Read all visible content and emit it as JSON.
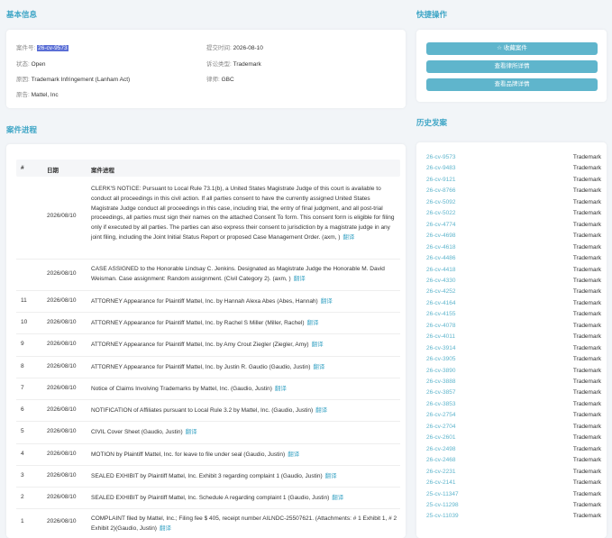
{
  "basic_info": {
    "title": "基本信息",
    "case_no_label": "案件号:",
    "case_no": "26-cv-9573",
    "filed_label": "提交时间:",
    "filed": "2026-08-10",
    "status_label": "状态:",
    "status": "Open",
    "type_label": "诉讼类型:",
    "type": "Trademark",
    "cause_label": "原因:",
    "cause": "Trademark Infringement (Lanham Act)",
    "lawyer_label": "律师:",
    "lawyer": "GBC",
    "plaintiff_label": "原告:",
    "plaintiff": "Mattel, Inc"
  },
  "quick_actions": {
    "title": "快捷操作",
    "favorite_icon": "star-icon",
    "favorite_label": "收藏案件",
    "lawyer_details": "查看律所详情",
    "brand_details": "查看品牌详情"
  },
  "progress": {
    "title": "案件进程",
    "col_num": "#",
    "col_date": "日期",
    "col_text": "案件进程",
    "translate_label": "翻译",
    "rows": [
      {
        "num": "",
        "date": "2026/08/10",
        "text": "CLERK'S NOTICE: Pursuant to Local Rule 73.1(b), a United States Magistrate Judge of this court is available to conduct all proceedings in this civil action. If all parties consent to have the currently assigned United States Magistrate Judge conduct all proceedings in this case, including trial, the entry of final judgment, and all post-trial proceedings, all parties must sign their names on the attached Consent To form. This consent form is eligible for filing only if executed by all parties. The parties can also express their consent to jurisdiction by a magistrate judge in any joint filing, including the Joint Initial Status Report or proposed Case Management Order. (axm, )"
      },
      {
        "num": "",
        "date": "2026/08/10",
        "text": "CASE ASSIGNED to the Honorable Lindsay C. Jenkins. Designated as Magistrate Judge the Honorable M. David Weisman. Case assignment: Random assignment. (Civil Category 2). (axm, )"
      },
      {
        "num": "11",
        "date": "2026/08/10",
        "text": "ATTORNEY Appearance for Plaintiff Mattel, Inc. by Hannah Alexa Abes (Abes, Hannah)"
      },
      {
        "num": "10",
        "date": "2026/08/10",
        "text": "ATTORNEY Appearance for Plaintiff Mattel, Inc. by Rachel S Miller (Miller, Rachel)"
      },
      {
        "num": "9",
        "date": "2026/08/10",
        "text": "ATTORNEY Appearance for Plaintiff Mattel, Inc. by Amy Crout Ziegler (Ziegler, Amy)"
      },
      {
        "num": "8",
        "date": "2026/08/10",
        "text": "ATTORNEY Appearance for Plaintiff Mattel, Inc. by Justin R. Gaudio (Gaudio, Justin)"
      },
      {
        "num": "7",
        "date": "2026/08/10",
        "text": "Notice of Claims Involving Trademarks by Mattel, Inc. (Gaudio, Justin)"
      },
      {
        "num": "6",
        "date": "2026/08/10",
        "text": "NOTIFICATION of Affiliates pursuant to Local Rule 3.2 by Mattel, Inc. (Gaudio, Justin)"
      },
      {
        "num": "5",
        "date": "2026/08/10",
        "text": "CIVIL Cover Sheet (Gaudio, Justin)"
      },
      {
        "num": "4",
        "date": "2026/08/10",
        "text": "MOTION by Plaintiff Mattel, Inc. for leave to file under seal (Gaudio, Justin)"
      },
      {
        "num": "3",
        "date": "2026/08/10",
        "text": "SEALED EXHIBIT by Plaintiff Mattel, Inc. Exhibit 3 regarding complaint 1 (Gaudio, Justin)"
      },
      {
        "num": "2",
        "date": "2026/08/10",
        "text": "SEALED EXHIBIT by Plaintiff Mattel, Inc. Schedule A regarding complaint 1 (Gaudio, Justin)"
      },
      {
        "num": "1",
        "date": "2026/08/10",
        "text": "COMPLAINT filed by Mattel, Inc.; Filing fee $ 405, receipt number AILNDC-25507621. (Attachments: # 1 Exhibit 1, # 2 Exhibit 2)(Gaudio, Justin)"
      }
    ]
  },
  "history": {
    "title": "历史发案",
    "items": [
      {
        "case": "26-cv-9573",
        "type": "Trademark"
      },
      {
        "case": "26-cv-9483",
        "type": "Trademark"
      },
      {
        "case": "26-cv-9121",
        "type": "Trademark"
      },
      {
        "case": "26-cv-8766",
        "type": "Trademark"
      },
      {
        "case": "26-cv-5092",
        "type": "Trademark"
      },
      {
        "case": "26-cv-5022",
        "type": "Trademark"
      },
      {
        "case": "26-cv-4774",
        "type": "Trademark"
      },
      {
        "case": "26-cv-4698",
        "type": "Trademark"
      },
      {
        "case": "26-cv-4618",
        "type": "Trademark"
      },
      {
        "case": "26-cv-4486",
        "type": "Trademark"
      },
      {
        "case": "26-cv-4418",
        "type": "Trademark"
      },
      {
        "case": "26-cv-4330",
        "type": "Trademark"
      },
      {
        "case": "26-cv-4252",
        "type": "Trademark"
      },
      {
        "case": "26-cv-4164",
        "type": "Trademark"
      },
      {
        "case": "26-cv-4155",
        "type": "Trademark"
      },
      {
        "case": "26-cv-4078",
        "type": "Trademark"
      },
      {
        "case": "26-cv-4011",
        "type": "Trademark"
      },
      {
        "case": "26-cv-3914",
        "type": "Trademark"
      },
      {
        "case": "26-cv-3905",
        "type": "Trademark"
      },
      {
        "case": "26-cv-3890",
        "type": "Trademark"
      },
      {
        "case": "26-cv-3888",
        "type": "Trademark"
      },
      {
        "case": "26-cv-3857",
        "type": "Trademark"
      },
      {
        "case": "26-cv-3853",
        "type": "Trademark"
      },
      {
        "case": "26-cv-2754",
        "type": "Trademark"
      },
      {
        "case": "26-cv-2704",
        "type": "Trademark"
      },
      {
        "case": "26-cv-2601",
        "type": "Trademark"
      },
      {
        "case": "26-cv-2498",
        "type": "Trademark"
      },
      {
        "case": "26-cv-2468",
        "type": "Trademark"
      },
      {
        "case": "26-cv-2231",
        "type": "Trademark"
      },
      {
        "case": "26-cv-2141",
        "type": "Trademark"
      },
      {
        "case": "25-cv-11347",
        "type": "Trademark"
      },
      {
        "case": "25-cv-11298",
        "type": "Trademark"
      },
      {
        "case": "25-cv-11039",
        "type": "Trademark"
      }
    ]
  }
}
